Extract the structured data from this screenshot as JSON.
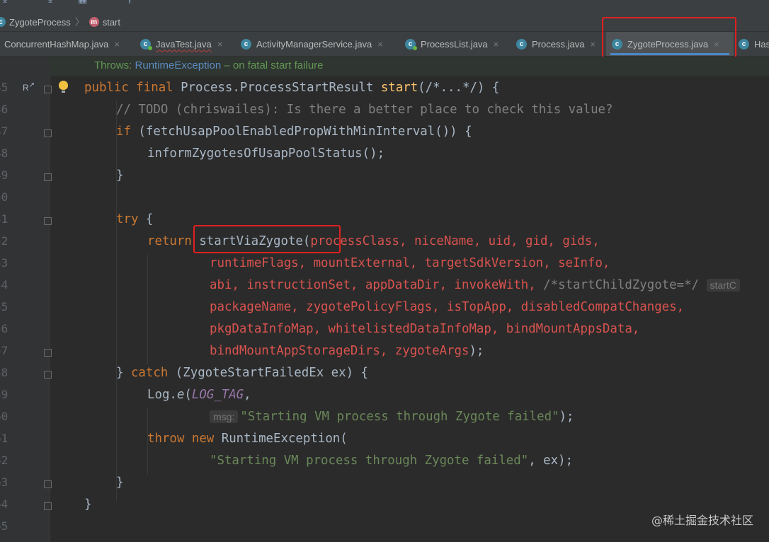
{
  "breadcrumb": {
    "class_name": "ZygoteProcess",
    "method_name": "start"
  },
  "tabs": [
    {
      "label": "ConcurrentHashMap.java",
      "active": false
    },
    {
      "label": "JavaTest.java",
      "active": false
    },
    {
      "label": "ActivityManagerService.java",
      "active": false
    },
    {
      "label": "ProcessList.java",
      "active": false
    },
    {
      "label": "Process.java",
      "active": false
    },
    {
      "label": "ZygoteProcess.java",
      "active": true
    },
    {
      "label": "Has",
      "active": false
    }
  ],
  "tab_close_glyph": "×",
  "javadoc": {
    "throws_label": "Throws:",
    "exception": "RuntimeException",
    "description": " – on fatal start failure"
  },
  "line_numbers": [
    "45",
    "46",
    "47",
    "48",
    "49",
    "50",
    "51",
    "52",
    "53",
    "54",
    "55",
    "56",
    "57",
    "58",
    "59",
    "60",
    "61",
    "62",
    "63",
    "64",
    "65"
  ],
  "gutter_marks": {
    "override": "R",
    "override_arrow": "↗"
  },
  "code": {
    "l45": {
      "kw": "public final",
      "sig": " Process.ProcessStartResult ",
      "name": "start",
      "args": "(/*...*/) {"
    },
    "l46": "// TODO (chriswailes): Is there a better place to check this value?",
    "l47": {
      "kw": "if",
      "rest": " (fetchUsapPoolEnabledPropWithMinInterval()) {"
    },
    "l48": "informZygotesOfUsapPoolStatus();",
    "l49": "}",
    "l51": {
      "kw": "try",
      "rest": " {"
    },
    "l52": {
      "kw": "return",
      "call": "startViaZygote(",
      "args": "processClass, niceName, uid, gid, gids,"
    },
    "l53": "runtimeFlags, mountExternal, targetSdkVersion, seInfo,",
    "l54": {
      "args": "abi, instructionSet, appDataDir, invokeWith, ",
      "comment": "/*startChildZygote=*/",
      "hint": "startC"
    },
    "l55": "packageName, zygotePolicyFlags, isTopApp, disabledCompatChanges,",
    "l56": "pkgDataInfoMap, whitelistedDataInfoMap, bindMountAppsData,",
    "l57": {
      "args": "bindMountAppStorageDirs, zygoteArgs",
      "end": ");"
    },
    "l58": {
      "brace": "} ",
      "kw": "catch",
      "rest": " (ZygoteStartFailedEx ex) {"
    },
    "l59": {
      "pre": "Log.",
      "method": "e",
      "paren": "(",
      "field": "LOG_TAG",
      "post": ","
    },
    "l60": {
      "hint": "msg:",
      "str": "\"Starting VM process through Zygote failed\"",
      "end": ");"
    },
    "l61": {
      "kw1": "throw",
      "kw2": "new",
      "rest": " RuntimeException("
    },
    "l62": {
      "str": "\"Starting VM process through Zygote failed\"",
      "end": ", ex);"
    },
    "l63": "}",
    "l64": "}"
  },
  "watermark": "@稀土掘金技术社区",
  "colors": {
    "highlight_box": "#e0201f",
    "active_tab_underline": "#4a88c7"
  }
}
